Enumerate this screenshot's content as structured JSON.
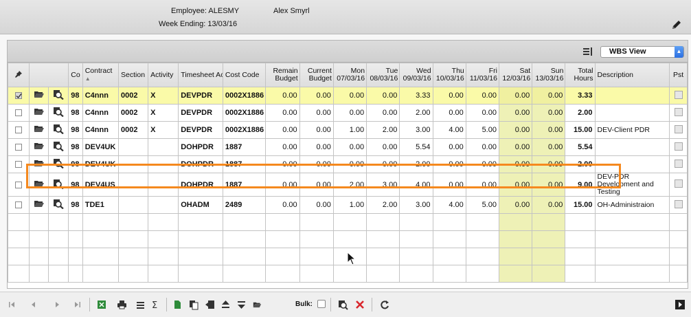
{
  "header": {
    "employee_label": "Employee: ALESMY",
    "employee_name": "Alex Smyrl",
    "week_ending": "Week Ending: 13/03/16"
  },
  "toolbar": {
    "view_select": "WBS View"
  },
  "columns": {
    "co": "Co",
    "contract": "Contract",
    "section": "Section",
    "activity": "Activity",
    "timesheet_activity": "Timesheet Activity",
    "cost_code": "Cost Code",
    "remain_budget": "Remain Budget",
    "current_budget": "Current Budget",
    "mon": "Mon",
    "mon_date": "07/03/16",
    "tue": "Tue",
    "tue_date": "08/03/16",
    "wed": "Wed",
    "wed_date": "09/03/16",
    "thu": "Thu",
    "thu_date": "10/03/16",
    "fri": "Fri",
    "fri_date": "11/03/16",
    "sat": "Sat",
    "sat_date": "12/03/16",
    "sun": "Sun",
    "sun_date": "13/03/16",
    "total_hours": "Total Hours",
    "description": "Description",
    "pst": "Pst"
  },
  "rows": [
    {
      "checked": true,
      "co": "98",
      "contract": "C4nnn",
      "section": "0002",
      "activity": "X",
      "ts_activity": "DEVPDR",
      "cost_code": "0002X1886",
      "remain": "0.00",
      "current": "0.00",
      "mon": "0.00",
      "tue": "0.00",
      "wed": "3.33",
      "thu": "0.00",
      "fri": "0.00",
      "sat": "0.00",
      "sun": "0.00",
      "total": "3.33",
      "desc": ""
    },
    {
      "checked": false,
      "co": "98",
      "contract": "C4nnn",
      "section": "0002",
      "activity": "X",
      "ts_activity": "DEVPDR",
      "cost_code": "0002X1886",
      "remain": "0.00",
      "current": "0.00",
      "mon": "0.00",
      "tue": "0.00",
      "wed": "2.00",
      "thu": "0.00",
      "fri": "0.00",
      "sat": "0.00",
      "sun": "0.00",
      "total": "2.00",
      "desc": ""
    },
    {
      "checked": false,
      "co": "98",
      "contract": "C4nnn",
      "section": "0002",
      "activity": "X",
      "ts_activity": "DEVPDR",
      "cost_code": "0002X1886",
      "remain": "0.00",
      "current": "0.00",
      "mon": "1.00",
      "tue": "2.00",
      "wed": "3.00",
      "thu": "4.00",
      "fri": "5.00",
      "sat": "0.00",
      "sun": "0.00",
      "total": "15.00",
      "desc": "DEV-Client PDR"
    },
    {
      "checked": false,
      "co": "98",
      "contract": "DEV4UK",
      "section": "",
      "activity": "",
      "ts_activity": "DOHPDR",
      "cost_code": "1887",
      "remain": "0.00",
      "current": "0.00",
      "mon": "0.00",
      "tue": "0.00",
      "wed": "5.54",
      "thu": "0.00",
      "fri": "0.00",
      "sat": "0.00",
      "sun": "0.00",
      "total": "5.54",
      "desc": ""
    },
    {
      "checked": false,
      "co": "98",
      "contract": "DEV4UK",
      "section": "",
      "activity": "",
      "ts_activity": "DOHPDR",
      "cost_code": "1887",
      "remain": "0.00",
      "current": "0.00",
      "mon": "0.00",
      "tue": "0.00",
      "wed": "2.00",
      "thu": "0.00",
      "fri": "0.00",
      "sat": "0.00",
      "sun": "0.00",
      "total": "2.00",
      "desc": ""
    },
    {
      "checked": false,
      "co": "98",
      "contract": "DEV4US",
      "section": "",
      "activity": "",
      "ts_activity": "DOHPDR",
      "cost_code": "1887",
      "remain": "0.00",
      "current": "0.00",
      "mon": "2.00",
      "tue": "3.00",
      "wed": "4.00",
      "thu": "0.00",
      "fri": "0.00",
      "sat": "0.00",
      "sun": "0.00",
      "total": "9.00",
      "desc": "DEV-PDR Development and Testing"
    },
    {
      "checked": false,
      "co": "98",
      "contract": "TDE1",
      "section": "",
      "activity": "",
      "ts_activity": "OHADM",
      "cost_code": "2489",
      "remain": "0.00",
      "current": "0.00",
      "mon": "1.00",
      "tue": "2.00",
      "wed": "3.00",
      "thu": "4.00",
      "fri": "5.00",
      "sat": "0.00",
      "sun": "0.00",
      "total": "15.00",
      "desc": "OH-Administraion"
    }
  ],
  "bottom": {
    "bulk_label": "Bulk:"
  },
  "colors": {
    "selected_row": "#fafaa8",
    "weekend": "#eef1b6",
    "highlight": "#f5891e",
    "delete_red": "#d9262c",
    "excel_green": "#2e8b3a"
  }
}
